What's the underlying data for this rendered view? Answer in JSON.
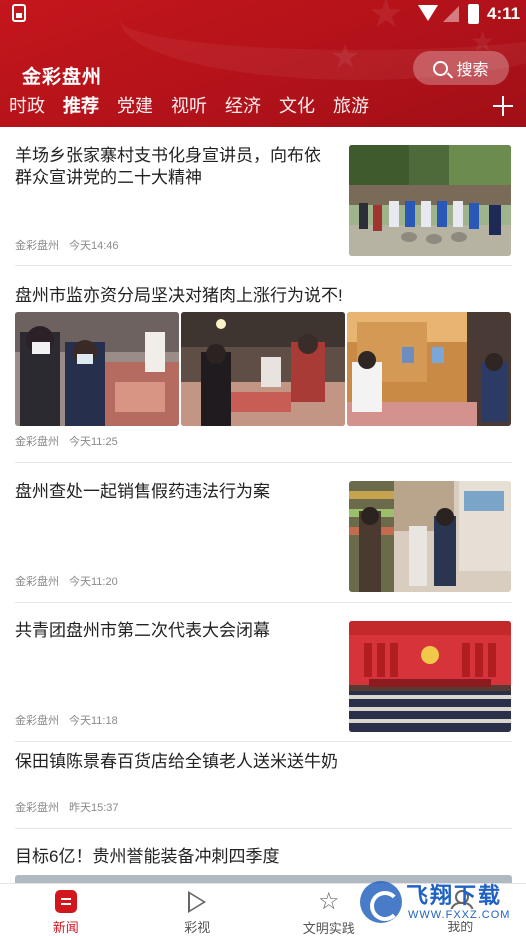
{
  "status_bar": {
    "time": "4:11"
  },
  "header": {
    "app_title": "金彩盘州",
    "search_label": "搜索",
    "tabs": [
      {
        "label": "时政",
        "active": false
      },
      {
        "label": "推荐",
        "active": true
      },
      {
        "label": "党建",
        "active": false
      },
      {
        "label": "视听",
        "active": false
      },
      {
        "label": "经济",
        "active": false
      },
      {
        "label": "文化",
        "active": false
      },
      {
        "label": "旅游",
        "active": false
      }
    ]
  },
  "articles": [
    {
      "title": "羊场乡张家寨村支书化身宣讲员，向布依群众宣讲党的二十大精神",
      "source": "金彩盘州",
      "time": "今天14:46"
    },
    {
      "title": "盘州市监亦资分局坚决对猪肉上涨行为说不!",
      "source": "金彩盘州",
      "time": "今天11:25"
    },
    {
      "title": "盘州查处一起销售假药违法行为案",
      "source": "金彩盘州",
      "time": "今天11:20"
    },
    {
      "title": "共青团盘州市第二次代表大会闭幕",
      "source": "金彩盘州",
      "time": "今天11:18"
    },
    {
      "title": "保田镇陈景春百货店给全镇老人送米送牛奶",
      "source": "金彩盘州",
      "time": "昨天15:37"
    },
    {
      "title": "目标6亿！贵州誉能装备冲刺四季度"
    }
  ],
  "bottom_nav": [
    {
      "label": "新闻",
      "icon": "news-icon",
      "active": true
    },
    {
      "label": "彩视",
      "icon": "play-icon",
      "active": false
    },
    {
      "label": "文明实践",
      "icon": "star-icon",
      "active": false
    },
    {
      "label": "我的",
      "icon": "user-icon",
      "active": false
    }
  ],
  "watermark": {
    "main": "飞翔下载",
    "sub": "WWW.FXXZ.COM"
  },
  "colors": {
    "brand_red": "#c4161c",
    "active_nav": "#d2161e"
  }
}
